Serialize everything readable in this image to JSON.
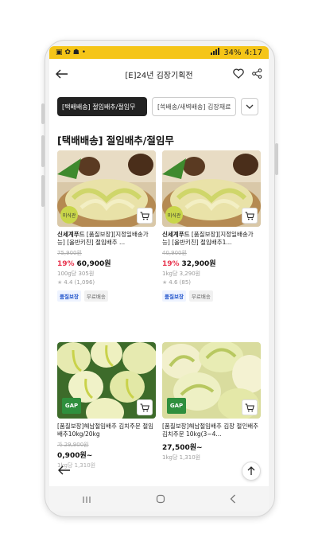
{
  "statusbar": {
    "battery": "34%",
    "time": "4:17",
    "icons_left": "▣ ✿ ☗ •"
  },
  "header": {
    "title": "[E]24년 김장기획전"
  },
  "chips": [
    {
      "label": "[택배배송] 절임배추/절임무"
    },
    {
      "label": "[쓱배송/새벽배송] 김장재료"
    }
  ],
  "section": {
    "title": "[택배배송] 절임배추/절임무"
  },
  "products": [
    {
      "badge": "미식관",
      "brand": "신세계푸드",
      "name": " [품질보장][지정일배송가능] [올반키친] 절임배추 ...",
      "original_price": "75,900원",
      "discount": "19%",
      "price": "60,900원",
      "unit_price": "100g당 305원",
      "rating": "4.4 (1,096)",
      "tags": [
        "품질보장",
        "무료배송"
      ]
    },
    {
      "badge": "미식관",
      "brand": "신세계푸드",
      "name": " [품질보장][지정일배송가능] [올반키친] 절임배추1...",
      "original_price": "40,900원",
      "discount": "19%",
      "price": "32,900원",
      "unit_price": "1kg당 3,290원",
      "rating": "4.6 (85)",
      "tags": [
        "품질보장",
        "무료배송"
      ]
    },
    {
      "badge": "GAP",
      "name": "[품질보장]해남절임배추 김치주문 절임배추10kg/20kg",
      "original_price": "가 29,900원",
      "price": "0,900원~",
      "unit_price": "1kg당 1,310원"
    },
    {
      "badge": "GAP",
      "name": "[품질보장]해남절임배추 김장 절인배추 김치주문 10kg(3~4...",
      "price": "27,500원~",
      "unit_price": "1kg당 1,310원"
    }
  ]
}
